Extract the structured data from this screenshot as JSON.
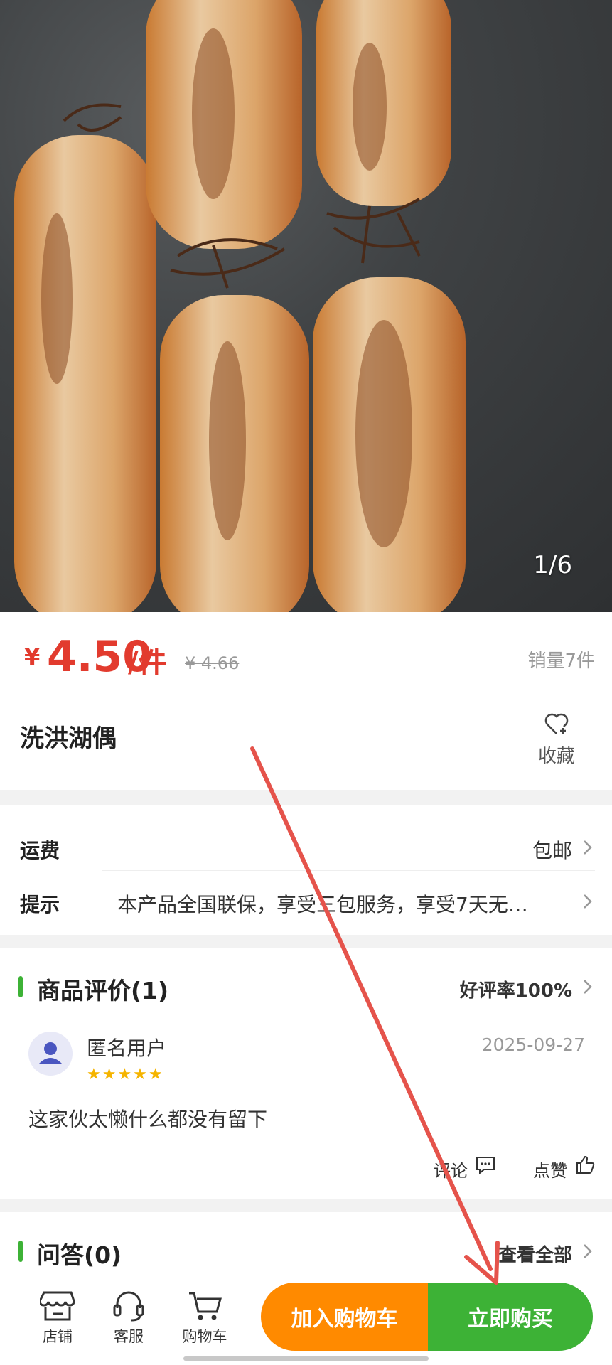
{
  "gallery": {
    "counter": "1/6"
  },
  "product": {
    "currency": "¥",
    "price": "4.50",
    "unit": "/件",
    "original_price": "¥ 4.66",
    "sales": "销量7件",
    "title": "洗洪湖偶",
    "favorite_label": "收藏"
  },
  "info_rows": {
    "shipping_label": "运费",
    "shipping_value": "包邮",
    "tip_label": "提示",
    "tip_value": "本产品全国联保，享受三包服务，享受7天无…"
  },
  "reviews": {
    "title": "商品评价(1)",
    "rating": "好评率100%",
    "item": {
      "user": "匿名用户",
      "stars": "★★★★★",
      "date": "2025-09-27",
      "text": "这家伙太懒什么都没有留下",
      "comment_label": "评论",
      "like_label": "点赞"
    }
  },
  "qa": {
    "title": "问答(0)",
    "view_all": "查看全部"
  },
  "bottom_bar": {
    "shop_label": "店铺",
    "service_label": "客服",
    "cart_label": "购物车",
    "add_to_cart": "加入购物车",
    "buy_now": "立即购买"
  },
  "colors": {
    "price": "#e23b2e",
    "accent_green": "#3db236",
    "accent_orange": "#ff8a00",
    "star": "#f5b400",
    "annotation_arrow": "#e5534b"
  }
}
